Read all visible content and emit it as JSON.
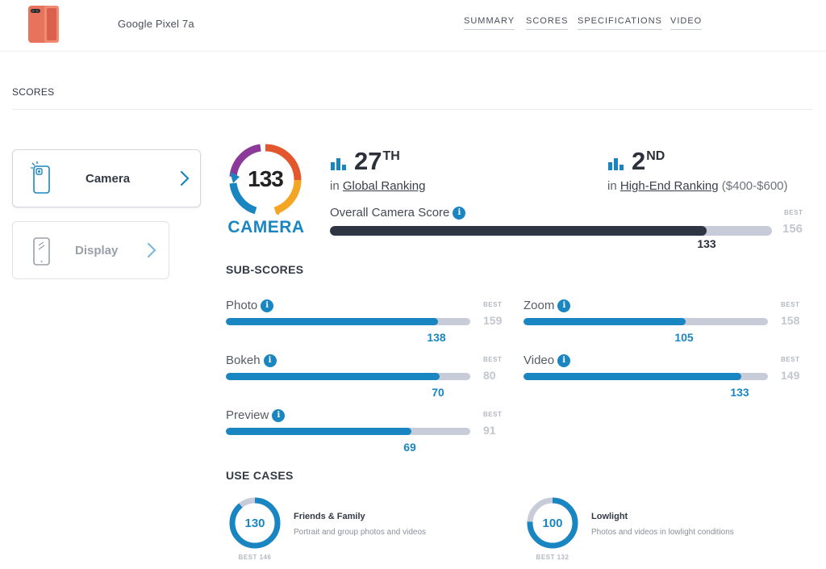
{
  "header": {
    "device_name": "Google Pixel 7a",
    "nav": [
      "SUMMARY",
      "SCORES",
      "SPECIFICATIONS",
      "VIDEO"
    ]
  },
  "section": {
    "label": "SCORES"
  },
  "categories": [
    {
      "label": "Camera",
      "icon": "phone-camera-icon",
      "active": true
    },
    {
      "label": "Display",
      "icon": "phone-display-icon",
      "active": false
    }
  ],
  "badge": {
    "score": "133",
    "label": "CAMERA"
  },
  "global_ranking": {
    "rank": "27",
    "suffix": "TH",
    "prefix": "in",
    "link": "Global Ranking"
  },
  "segment_ranking": {
    "rank": "2",
    "suffix": "ND",
    "prefix": "in",
    "link": "High-End Ranking",
    "range": "($400-$600)"
  },
  "overall": {
    "label": "Overall Camera Score",
    "value": 133,
    "best": 156,
    "best_label": "BEST"
  },
  "subscores": {
    "heading": "SUB-SCORES",
    "items": [
      {
        "label": "Photo",
        "value": 138,
        "best": 159
      },
      {
        "label": "Zoom",
        "value": 105,
        "best": 158
      },
      {
        "label": "Bokeh",
        "value": 70,
        "best": 80
      },
      {
        "label": "Video",
        "value": 133,
        "best": 149
      },
      {
        "label": "Preview",
        "value": 69,
        "best": 91
      }
    ]
  },
  "use_cases": {
    "heading": "USE CASES",
    "items": [
      {
        "value": 130,
        "best": 146,
        "best_text": "BEST 146",
        "title": "Friends & Family",
        "desc": "Portrait and group photos and videos"
      },
      {
        "value": 100,
        "best": 132,
        "best_text": "BEST 132",
        "title": "Lowlight",
        "desc": "Photos and videos in lowlight conditions"
      }
    ]
  },
  "colors": {
    "accent": "#1a86c1",
    "dark_bar": "#2f3542",
    "track": "#c8ccd8",
    "phone": "#e8735c"
  }
}
